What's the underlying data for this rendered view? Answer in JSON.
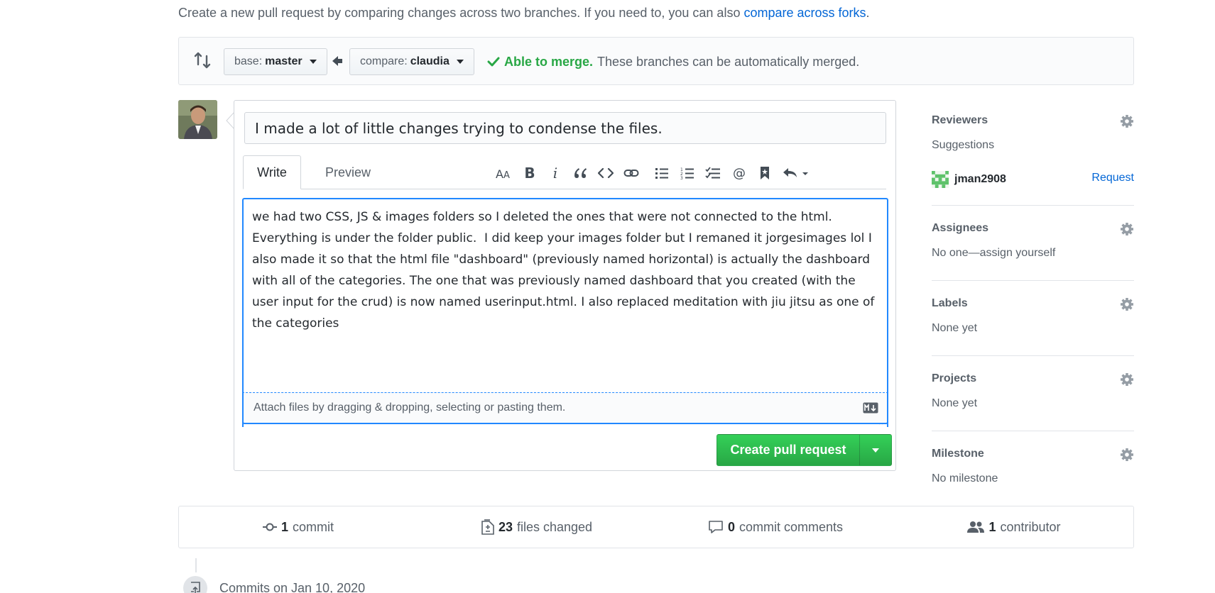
{
  "intro": {
    "text": "Create a new pull request by comparing changes across two branches. If you need to, you can also ",
    "link": "compare across forks",
    "suffix": "."
  },
  "range": {
    "base_prefix": "base:",
    "base_branch": "master",
    "compare_prefix": "compare:",
    "compare_branch": "claudia",
    "merge_ok": "Able to merge.",
    "merge_detail": "These branches can be automatically merged."
  },
  "form": {
    "title_value": "I made a lot of little changes trying to condense the files.",
    "tab_write": "Write",
    "tab_preview": "Preview",
    "toolbar": {
      "header_icon": "text-size-icon",
      "bold_label": "B",
      "italic_label": "i"
    },
    "body_value": "we had two CSS, JS & images folders so I deleted the ones that were not connected to the html. Everything is under the folder public.  I did keep your images folder but I remaned it jorgesimages lol I also made it so that the html file \"dashboard\" (previously named horizontal) is actually the dashboard with all of the categories. The one that was previously named dashboard that you created (with the user input for the crud) is now named userinput.html. I also replaced meditation with jiu jitsu as one of the categories",
    "attach_text": "Attach files by dragging & dropping, selecting or pasting them.",
    "create_button": "Create pull request"
  },
  "sidebar": {
    "reviewers_title": "Reviewers",
    "reviewers_suggestions": "Suggestions",
    "reviewer_name": "jman2908",
    "reviewer_request": "Request",
    "assignees_title": "Assignees",
    "assignees_value": "No one—assign yourself",
    "labels_title": "Labels",
    "labels_value": "None yet",
    "projects_title": "Projects",
    "projects_value": "None yet",
    "milestone_title": "Milestone",
    "milestone_value": "No milestone"
  },
  "summary": {
    "commits_count": "1",
    "commits_label": "commit",
    "files_count": "23",
    "files_label": "files changed",
    "comments_count": "0",
    "comments_label": "commit comments",
    "contributors_count": "1",
    "contributors_label": "contributor"
  },
  "timeline": {
    "commits_date": "Commits on Jan 10, 2020"
  },
  "colors": {
    "link": "#0366d6",
    "success": "#28a745",
    "focus": "#2188ff"
  }
}
